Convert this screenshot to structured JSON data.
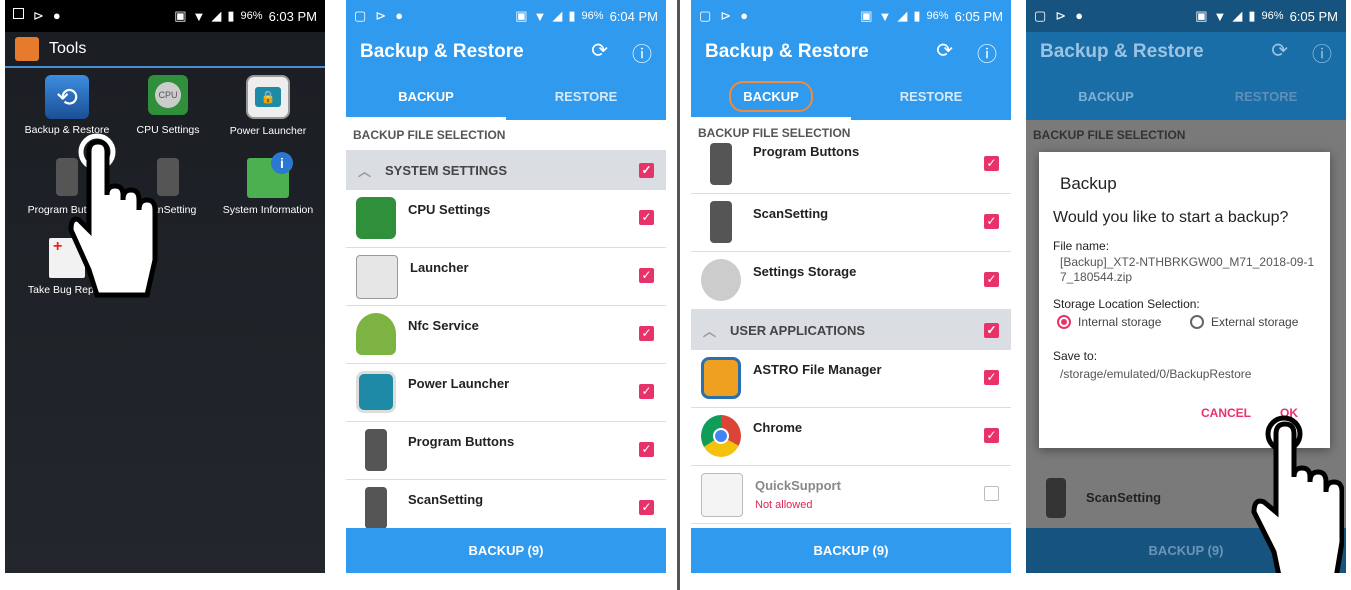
{
  "status": [
    {
      "battery": "96%",
      "time": "6:03 PM"
    },
    {
      "battery": "96%",
      "time": "6:04 PM"
    },
    {
      "battery": "96%",
      "time": "6:05 PM"
    },
    {
      "battery": "96%",
      "time": "6:05 PM"
    }
  ],
  "launcher": {
    "title": "Tools",
    "apps": [
      {
        "label": "Backup & Restore",
        "icon": "backup-restore-icon"
      },
      {
        "label": "CPU Settings",
        "icon": "cpu-icon"
      },
      {
        "label": "Power Launcher",
        "icon": "power-launcher-icon"
      },
      {
        "label": "Program Buttons",
        "icon": "scanner-device-icon"
      },
      {
        "label": "ScanSetting",
        "icon": "scan-setting-icon"
      },
      {
        "label": "System Information",
        "icon": "system-info-icon"
      },
      {
        "label": "Take Bug Report",
        "icon": "bug-report-icon"
      }
    ]
  },
  "app": {
    "title": "Backup & Restore",
    "tab_backup": "BACKUP",
    "tab_restore": "RESTORE",
    "section": "BACKUP FILE SELECTION",
    "bottom": "BACKUP (9)",
    "accent": "#2f9aee",
    "check_color": "#e8326a"
  },
  "screen2": {
    "group": "SYSTEM SETTINGS",
    "items": [
      {
        "label": "CPU Settings",
        "icon": "cpu-icon"
      },
      {
        "label": "Launcher",
        "icon": "launcher-icon"
      },
      {
        "label": "Nfc Service",
        "icon": "android-icon"
      },
      {
        "label": "Power Launcher",
        "icon": "power-launcher-icon"
      },
      {
        "label": "Program Buttons",
        "icon": "scanner-device-icon"
      },
      {
        "label": "ScanSetting",
        "icon": "scan-setting-icon"
      }
    ]
  },
  "screen3": {
    "items_top": [
      {
        "label": "Program Buttons",
        "icon": "scanner-device-icon"
      },
      {
        "label": "ScanSetting",
        "icon": "scan-setting-icon"
      },
      {
        "label": "Settings Storage",
        "icon": "gear-icon"
      }
    ],
    "group": "USER APPLICATIONS",
    "items_bottom": [
      {
        "label": "ASTRO File Manager",
        "icon": "folder-icon"
      },
      {
        "label": "Chrome",
        "icon": "chrome-icon"
      },
      {
        "label": "QuickSupport",
        "icon": "teamviewer-icon",
        "sub": "Not allowed"
      }
    ]
  },
  "dialog": {
    "title": "Backup",
    "question": "Would you like to start a backup?",
    "file_label": "File name:",
    "file_value": "[Backup]_XT2-NTHBRKGW00_M71_2018-09-17_180544.zip",
    "storage_label": "Storage Location Selection:",
    "internal": "Internal storage",
    "external": "External storage",
    "save_label": "Save to:",
    "save_value": "/storage/emulated/0/BackupRestore",
    "cancel": "CANCEL",
    "ok": "OK"
  },
  "screen4": {
    "behind_label": "ScanSetting"
  }
}
